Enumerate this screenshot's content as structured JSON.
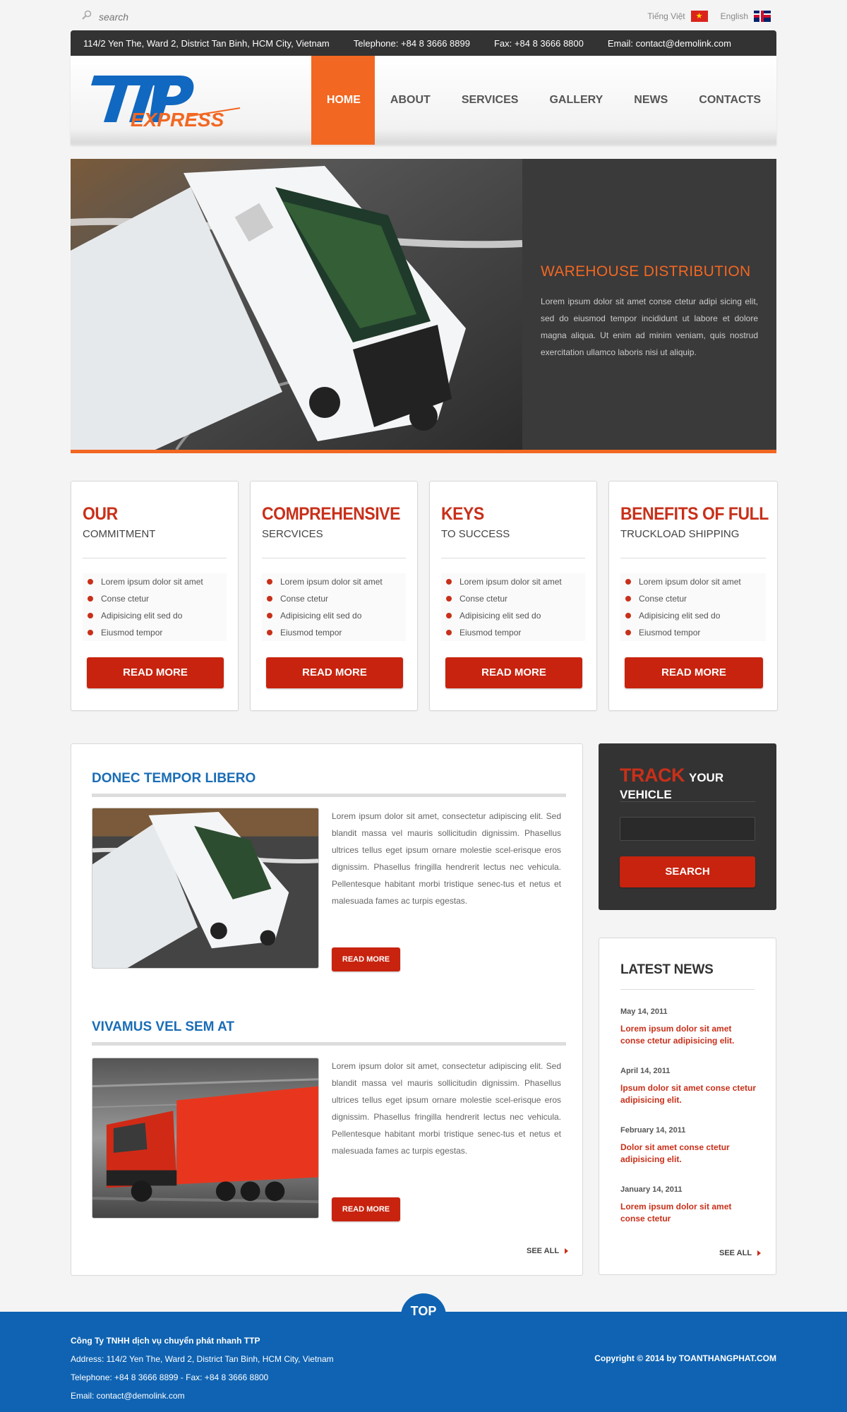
{
  "topbar": {
    "search_placeholder": "search",
    "lang_vi": "Tiếng Việt",
    "lang_en": "English"
  },
  "contact": {
    "address": "114/2 Yen The, Ward 2, District Tan Binh, HCM City, Vietnam",
    "telephone_label": "Telephone:",
    "telephone": "+84 8 3666 8899",
    "fax_label": "Fax:",
    "fax": "+84 8 3666 8800",
    "email_label": "Email:",
    "email": "contact@demolink.com"
  },
  "logo": {
    "letters": "TTP",
    "word": "EXPRESS"
  },
  "nav": {
    "items": [
      {
        "label": "HOME"
      },
      {
        "label": "ABOUT"
      },
      {
        "label": "SERVICES"
      },
      {
        "label": "GALLERY"
      },
      {
        "label": "NEWS"
      },
      {
        "label": "CONTACTS"
      }
    ]
  },
  "hero": {
    "title": "WAREHOUSE DISTRIBUTION",
    "text": "Lorem ipsum dolor sit amet conse ctetur adipi sicing elit, sed do eiusmod tempor incididunt ut labore et dolore magna aliqua. Ut enim ad minim veniam, quis nostrud exercitation ullamco laboris nisi ut aliquip."
  },
  "features": [
    {
      "title": "OUR",
      "subtitle": "COMMITMENT",
      "bullets": [
        "Lorem ipsum dolor sit amet",
        "Conse ctetur",
        "Adipisicing elit sed do",
        "Eiusmod tempor"
      ],
      "button": "READ MORE"
    },
    {
      "title": "COMPREHENSIVE",
      "subtitle": "SERCVICES",
      "bullets": [
        "Lorem ipsum dolor sit amet",
        "Conse ctetur",
        "Adipisicing elit sed do",
        "Eiusmod tempor"
      ],
      "button": "READ MORE"
    },
    {
      "title": "KEYS",
      "subtitle": "TO SUCCESS",
      "bullets": [
        "Lorem ipsum dolor sit amet",
        "Conse ctetur",
        "Adipisicing elit sed do",
        "Eiusmod tempor"
      ],
      "button": "READ MORE"
    },
    {
      "title": "BENEFITS OF FULL",
      "subtitle": "TRUCKLOAD SHIPPING",
      "bullets": [
        "Lorem ipsum dolor sit amet",
        "Conse ctetur",
        "Adipisicing elit sed do",
        "Eiusmod tempor"
      ],
      "button": "READ MORE"
    }
  ],
  "articles": [
    {
      "title": "DONEC TEMPOR LIBERO",
      "text": "Lorem ipsum dolor sit amet, consectetur adipiscing elit. Sed blandit massa vel mauris sollicitudin dignissim. Phasellus ultrices tellus eget ipsum ornare molestie scel-erisque eros dignissim. Phasellus fringilla hendrerit lectus nec vehicula. Pellentesque habitant morbi tristique senec-tus et netus et malesuada fames ac turpis egestas.",
      "button": "READ MORE"
    },
    {
      "title": "VIVAMUS VEL SEM AT",
      "text": "Lorem ipsum dolor sit amet, consectetur adipiscing elit. Sed blandit massa vel mauris sollicitudin dignissim. Phasellus ultrices tellus eget ipsum ornare molestie scel-erisque eros dignissim. Phasellus fringilla hendrerit lectus nec vehicula. Pellentesque habitant morbi tristique senec-tus et netus et malesuada fames ac turpis egestas.",
      "button": "READ MORE"
    }
  ],
  "main_see_all": "SEE ALL",
  "track": {
    "title_red": "TRACK",
    "title_white": "YOUR VEHICLE",
    "button": "SEARCH"
  },
  "news": {
    "title": "LATEST NEWS",
    "items": [
      {
        "date": "May 14, 2011",
        "text": "Lorem ipsum dolor sit amet conse ctetur adipisicing elit."
      },
      {
        "date": "April 14, 2011",
        "text": "Ipsum dolor sit amet conse ctetur adipisicing elit."
      },
      {
        "date": "February 14, 2011",
        "text": "Dolor sit amet conse ctetur adipisicing elit."
      },
      {
        "date": "January 14, 2011",
        "text": "Lorem ipsum dolor sit amet conse ctetur"
      }
    ],
    "see_all": "SEE ALL"
  },
  "footer": {
    "top": "TOP",
    "company": "Công Ty TNHH dịch vụ chuyển phát nhanh TTP",
    "address": "Address: 114/2 Yen The, Ward 2, District Tan Binh, HCM City, Vietnam",
    "phones": "Telephone: +84 8 3666 8899  -  Fax: +84 8 3666 8800",
    "email": "Email: contact@demolink.com",
    "copyright": "Copyright © 2014 by TOANTHANGPHAT.COM"
  },
  "colors": {
    "accent_orange": "#f26722",
    "accent_red": "#c8230e",
    "link_blue": "#1a6db6",
    "footer_blue": "#0f63b2"
  }
}
